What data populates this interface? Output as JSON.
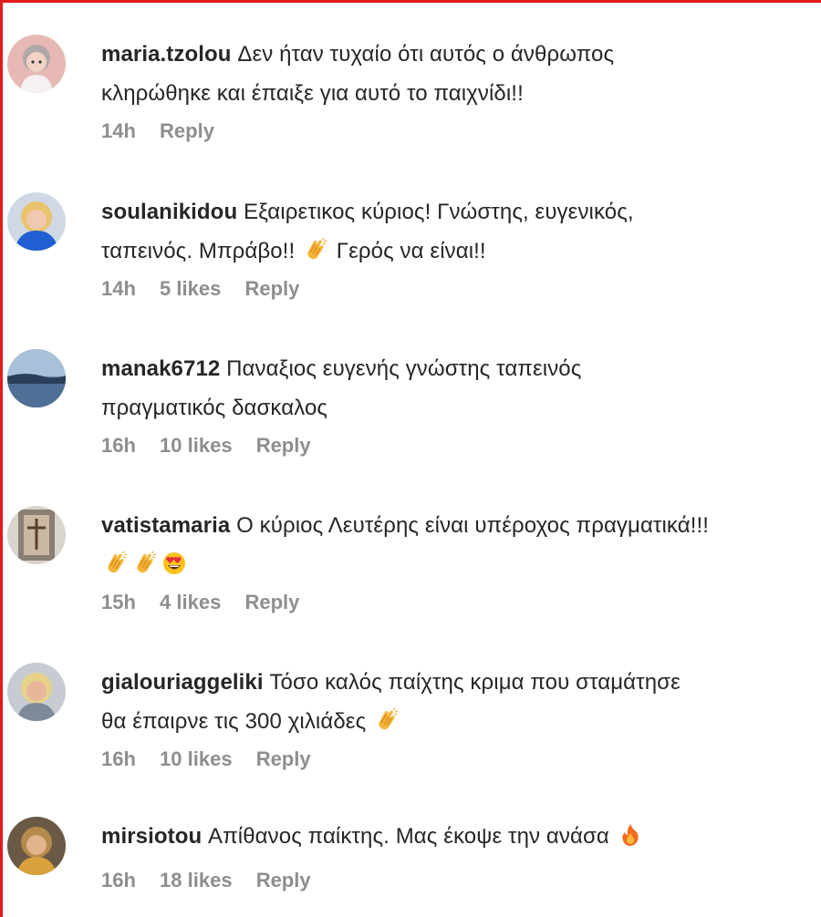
{
  "comments": [
    {
      "username": "maria.tzolou",
      "text_lines": [
        "Δεν ήταν τυχαίο ότι αυτός ο άνθρωπος",
        "κληρώθηκε και έπαιξε για αυτό το παιχνίδι!!"
      ],
      "time": "14h",
      "likes": "",
      "reply": "Reply"
    },
    {
      "username": "soulanikidou",
      "text_lines": [
        "Εξαιρετικος κύριος! Γνώστης, ευγενικός,",
        "ταπεινός. Μπράβο!!",
        "Γερός να είναι!!"
      ],
      "emoji_icon": "clapping-hands-icon",
      "time": "14h",
      "likes": "5 likes",
      "reply": "Reply"
    },
    {
      "username": "manak6712",
      "text_lines": [
        "Παναξιος ευγενής γνώστης ταπεινός",
        "πραγματικός δασκαλος"
      ],
      "time": "16h",
      "likes": "10 likes",
      "reply": "Reply"
    },
    {
      "username": "vatistamaria",
      "text_lines": [
        "Ο κύριος Λευτέρης είναι υπέροχος πραγματικά!!!"
      ],
      "emoji_icons": [
        "clapping-hands-icon",
        "clapping-hands-icon",
        "heart-eyes-icon"
      ],
      "time": "15h",
      "likes": "4 likes",
      "reply": "Reply"
    },
    {
      "username": "gialouriaggeliki",
      "text_lines": [
        "Τόσο καλός παίχτης κριμα που σταμάτησε",
        "θα έπαιρνε τις 300 χιλιάδες"
      ],
      "emoji_icon": "clapping-hands-icon",
      "time": "16h",
      "likes": "10 likes",
      "reply": "Reply"
    },
    {
      "username": "mirsiotou",
      "text_lines": [
        "Απίθανος παίκτης. Μας έκοψε την ανάσα"
      ],
      "emoji_icon": "fire-icon",
      "time": "16h",
      "likes": "18 likes",
      "reply": "Reply"
    }
  ],
  "colors": {
    "border": "#e21b1b",
    "text": "#262626",
    "meta": "#8e8e8e"
  }
}
